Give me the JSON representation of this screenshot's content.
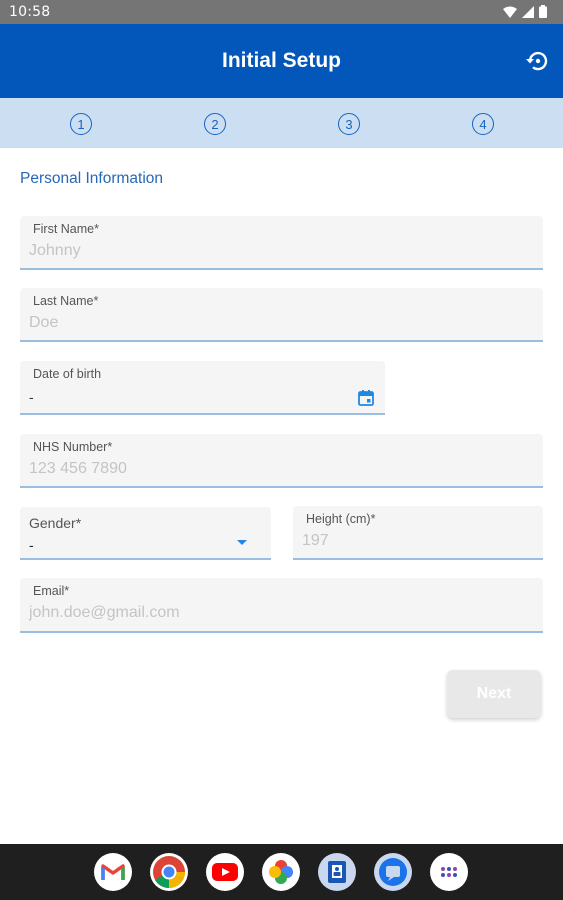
{
  "status_bar": {
    "time": "10:58"
  },
  "app_bar": {
    "title": "Initial Setup"
  },
  "stepper": {
    "steps": [
      "1",
      "2",
      "3",
      "4"
    ]
  },
  "form": {
    "section_title": "Personal Information",
    "first_name": {
      "label": "First Name*",
      "placeholder": "Johnny"
    },
    "last_name": {
      "label": "Last Name*",
      "placeholder": "Doe"
    },
    "dob": {
      "label": "Date of birth",
      "value": "-"
    },
    "nhs": {
      "label": "NHS Number*",
      "placeholder": "123 456 7890"
    },
    "gender": {
      "label": "Gender*",
      "value": "-"
    },
    "height": {
      "label": "Height (cm)*",
      "placeholder": "197"
    },
    "email": {
      "label": "Email*",
      "placeholder": "john.doe@gmail.com"
    },
    "next_label": "Next"
  },
  "colors": {
    "app_bar": "#0356ba",
    "stepper_bg": "#ccdff2",
    "accent": "#1565c0"
  },
  "dock": [
    "gmail-icon",
    "chrome-icon",
    "youtube-icon",
    "photos-icon",
    "contacts-icon",
    "messages-icon",
    "app-drawer-icon"
  ]
}
